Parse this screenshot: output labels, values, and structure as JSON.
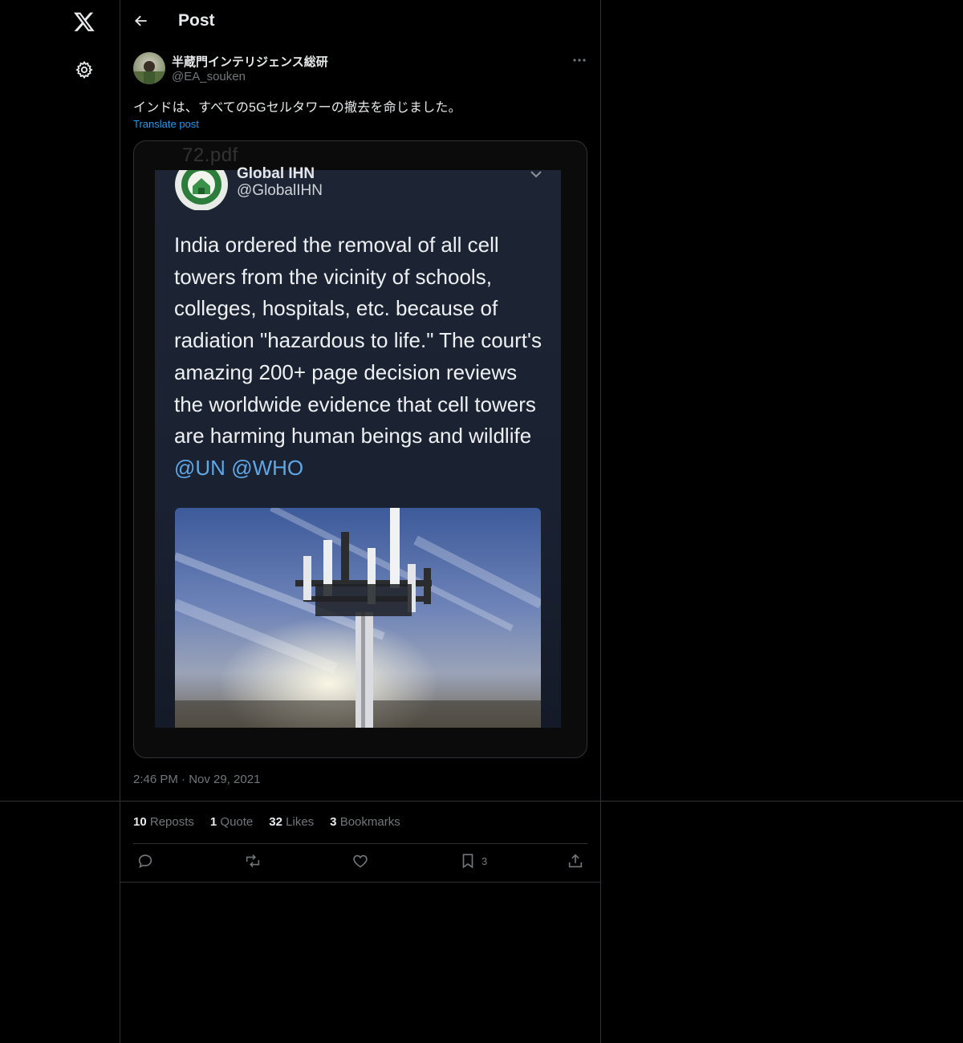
{
  "header": {
    "title": "Post",
    "back_label": "Back"
  },
  "author": {
    "name": "半蔵門インテリジェンス総研",
    "handle": "@EA_souken"
  },
  "post": {
    "text": "インドは、すべての5Gセルタワーの撤去を命じました。",
    "translate_label": "Translate post",
    "timestamp": "2:46 PM · Nov 29, 2021"
  },
  "media": {
    "file_label": "72.pdf",
    "embedded": {
      "name": "Global IHN",
      "handle": "@GlobalIHN",
      "text_main": "India ordered the removal of all cell towers from the vicinity of schools, colleges, hospitals, etc. because of radiation \"hazardous to life.\" The court's amazing 200+ page decision reviews the worldwide evidence that cell towers are harming human beings and wildlife ",
      "mention_1": "@UN",
      "mention_2": "@WHO"
    }
  },
  "stats": {
    "reposts_count": "10",
    "reposts_label": "Reposts",
    "quotes_count": "1",
    "quotes_label": "Quote",
    "likes_count": "32",
    "likes_label": "Likes",
    "bookmarks_count": "3",
    "bookmarks_label": "Bookmarks"
  },
  "actions": {
    "bookmark_count": "3"
  },
  "icons": {
    "logo": "x-logo-icon",
    "settings": "gear-icon",
    "back": "arrow-left-icon",
    "more": "more-horizontal-icon",
    "reply": "reply-icon",
    "repost": "repost-icon",
    "like": "heart-icon",
    "bookmark": "bookmark-icon",
    "share": "share-icon"
  },
  "colors": {
    "background": "#000000",
    "border": "#2f3336",
    "accent": "#1d9bf0",
    "muted": "#71767b",
    "text": "#e7e9ea"
  }
}
